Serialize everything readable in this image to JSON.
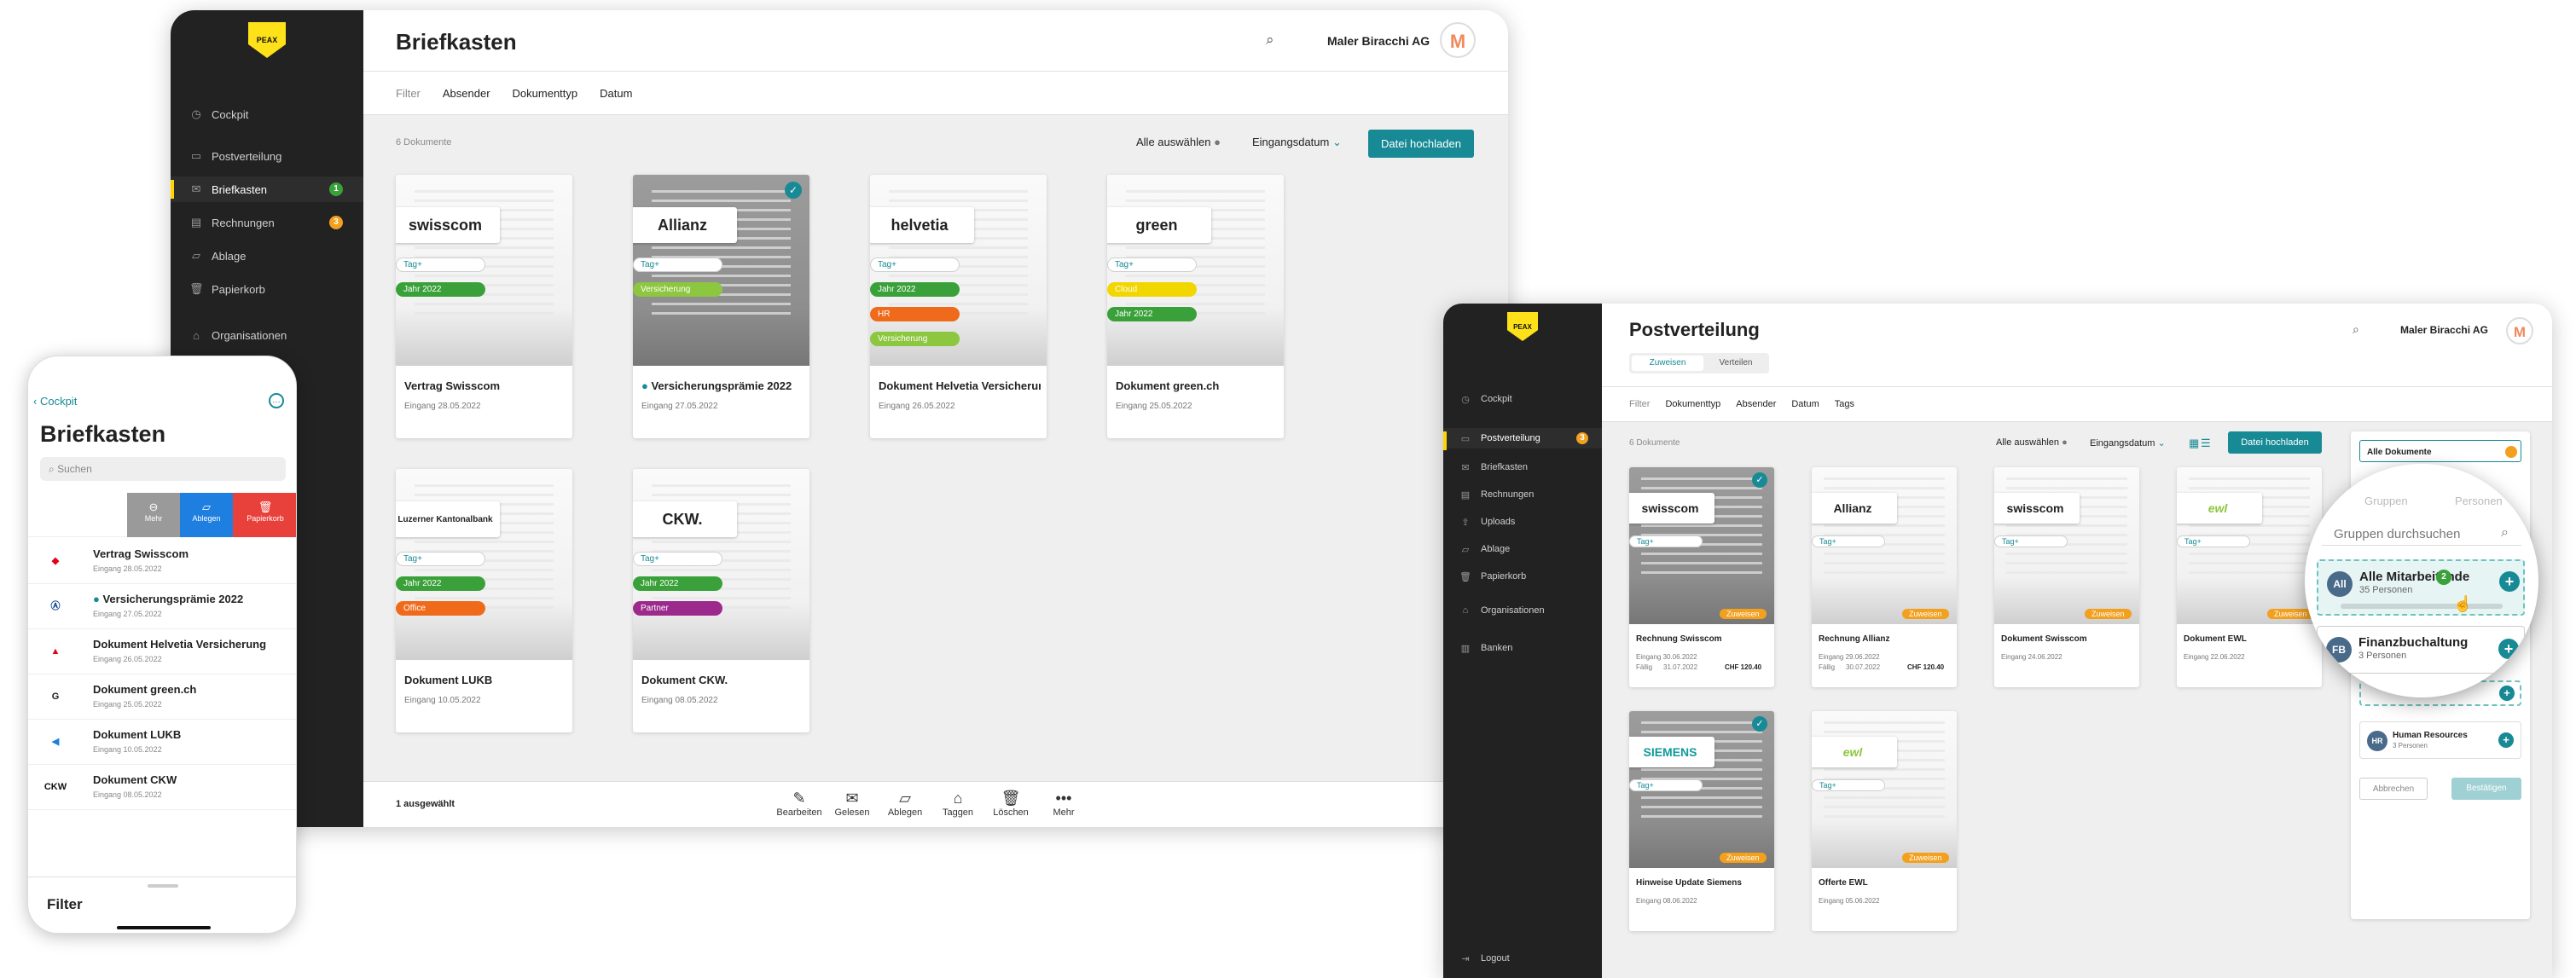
{
  "desktop": {
    "logo": "PEAX",
    "title": "Briefkasten",
    "company": "Maler Biracchi AG",
    "avatar_initial": "M",
    "nav": [
      {
        "label": "Cockpit",
        "icon": "clock"
      },
      {
        "label": "Postverteilung",
        "icon": "inbox"
      },
      {
        "label": "Briefkasten",
        "icon": "mail",
        "badge": "1"
      },
      {
        "label": "Rechnungen",
        "icon": "receipt",
        "badge": "3"
      },
      {
        "label": "Ablage",
        "icon": "folder"
      },
      {
        "label": "Papierkorb",
        "icon": "trash"
      },
      {
        "label": "Organisationen",
        "icon": "org"
      }
    ],
    "filter": {
      "label": "Filter",
      "items": [
        "Absender",
        "Dokumenttyp",
        "Datum"
      ]
    },
    "doc_count": "6 Dokumente",
    "select_all": "Alle auswählen",
    "sort": "Eingangsdatum",
    "upload": "Datei hochladen",
    "cards": [
      {
        "brand": "swisscom",
        "title": "Vertrag Swisscom",
        "date": "Eingang 28.05.2022",
        "tags": [
          {
            "label": "Tag+"
          },
          {
            "label": "Jahr 2022",
            "color": "#3aa13a"
          }
        ]
      },
      {
        "brand": "Allianz",
        "title": "Versicherungsprämie 2022",
        "date": "Eingang 27.05.2022",
        "selected": true,
        "unread": true,
        "tags": [
          {
            "label": "Tag+"
          },
          {
            "label": "Versicherung",
            "color": "#8dc63f"
          }
        ]
      },
      {
        "brand": "helvetia",
        "title": "Dokument Helvetia Versicherung",
        "date": "Eingang 26.05.2022",
        "tags": [
          {
            "label": "Tag+"
          },
          {
            "label": "Jahr 2022",
            "color": "#3aa13a"
          },
          {
            "label": "HR",
            "color": "#ef6a1b"
          },
          {
            "label": "Versicherung",
            "color": "#8dc63f"
          }
        ]
      },
      {
        "brand": "green",
        "title": "Dokument green.ch",
        "date": "Eingang 25.05.2022",
        "tags": [
          {
            "label": "Tag+"
          },
          {
            "label": "Cloud",
            "color": "#f2d600"
          },
          {
            "label": "Jahr 2022",
            "color": "#3aa13a"
          }
        ]
      },
      {
        "brand": "Luzerner Kantonalbank",
        "title": "Dokument LUKB",
        "date": "Eingang 10.05.2022",
        "tags": [
          {
            "label": "Tag+"
          },
          {
            "label": "Jahr 2022",
            "color": "#3aa13a"
          },
          {
            "label": "Office",
            "color": "#ef6a1b"
          }
        ]
      },
      {
        "brand": "CKW.",
        "title": "Dokument CKW.",
        "date": "Eingang 08.05.2022",
        "tags": [
          {
            "label": "Tag+"
          },
          {
            "label": "Jahr 2022",
            "color": "#3aa13a"
          },
          {
            "label": "Partner",
            "color": "#9c2a8d"
          }
        ]
      }
    ],
    "selected_count": "1 ausgewählt",
    "toolbar": [
      {
        "label": "Bearbeiten",
        "icon": "edit"
      },
      {
        "label": "Gelesen",
        "icon": "envelope-open"
      },
      {
        "label": "Ablegen",
        "icon": "folder"
      },
      {
        "label": "Taggen",
        "icon": "tag"
      },
      {
        "label": "Löschen",
        "icon": "trash"
      },
      {
        "label": "Mehr",
        "icon": "more"
      }
    ]
  },
  "phone": {
    "back": "Cockpit",
    "title": "Briefkasten",
    "search_placeholder": "Suchen",
    "swipe_actions": [
      {
        "label": "Mehr",
        "color": "#9a9a9a"
      },
      {
        "label": "Ablegen",
        "color": "#1f7fe0"
      },
      {
        "label": "Papierkorb",
        "color": "#e8403a"
      }
    ],
    "rows": [
      {
        "title": "Vertrag Swisscom",
        "date": "Eingang 28.05.2022",
        "icon": "swisscom"
      },
      {
        "title": "Versicherungsprämie 2022",
        "date": "Eingang 27.05.2022",
        "icon": "allianz",
        "unread": true
      },
      {
        "title": "Dokument Helvetia Versicherung",
        "date": "Eingang 26.05.2022",
        "icon": "helvetia"
      },
      {
        "title": "Dokument green.ch",
        "date": "Eingang 25.05.2022",
        "icon": "green"
      },
      {
        "title": "Dokument LUKB",
        "date": "Eingang 10.05.2022",
        "icon": "lukb"
      },
      {
        "title": "Dokument CKW",
        "date": "Eingang 08.05.2022",
        "icon": "ckw"
      }
    ],
    "footer": "Filter"
  },
  "tablet": {
    "logo": "PEAX",
    "title": "Postverteilung",
    "company": "Maler Biracchi AG",
    "avatar_initial": "M",
    "tabs": [
      "Zuweisen",
      "Verteilen"
    ],
    "nav": [
      {
        "label": "Cockpit"
      },
      {
        "label": "Postverteilung",
        "badge": "3"
      },
      {
        "label": "Briefkasten"
      },
      {
        "label": "Rechnungen"
      },
      {
        "label": "Uploads"
      },
      {
        "label": "Ablage"
      },
      {
        "label": "Papierkorb"
      },
      {
        "label": "Organisationen"
      },
      {
        "label": "Banken"
      }
    ],
    "logout": "Logout",
    "filter": {
      "label": "Filter",
      "items": [
        "Dokumenttyp",
        "Absender",
        "Datum",
        "Tags"
      ]
    },
    "doc_count": "6 Dokumente",
    "select_all": "Alle auswählen",
    "sort": "Eingangsdatum",
    "upload": "Datei hochladen",
    "cards": [
      {
        "brand": "swisscom",
        "title": "Rechnung Swisscom",
        "date": "Eingang 30.06.2022",
        "due": "Fällig",
        "due_date": "31.07.2022",
        "amount": "CHF 120.40",
        "selected": true,
        "status": "Zuweisen"
      },
      {
        "brand": "Allianz",
        "title": "Rechnung Allianz",
        "date": "Eingang 29.06.2022",
        "due": "Fällig",
        "due_date": "30.07.2022",
        "amount": "CHF 120.40",
        "status": "Zuweisen"
      },
      {
        "brand": "swisscom",
        "title": "Dokument Swisscom",
        "date": "Eingang 24.06.2022",
        "status": "Zuweisen"
      },
      {
        "brand": "ewl",
        "title": "Dokument EWL",
        "date": "Eingang 22.06.2022",
        "status": "Zuweisen"
      },
      {
        "brand": "SIEMENS",
        "title": "Hinweise Update Siemens",
        "date": "Eingang 08.06.2022",
        "selected": true,
        "status": "Zuweisen"
      },
      {
        "brand": "ewl",
        "title": "Offerte EWL",
        "date": "Eingang 05.06.2022",
        "status": "Zuweisen"
      }
    ],
    "panel": {
      "all_docs": "Alle Dokumente",
      "tabs": [
        "Gruppen",
        "Personen"
      ],
      "search_placeholder": "Gruppen durchsuchen",
      "groups": [
        {
          "initials": "All",
          "name": "Alle Mitarbeitende",
          "count": "35 Personen",
          "color": "#4a6a8a"
        },
        {
          "initials": "FB",
          "name": "Finanzbuchaltung",
          "count": "3 Personen",
          "color": "#4a6a8a"
        },
        {
          "initials": "HR",
          "name": "Human Resources",
          "count": "3 Personen",
          "color": "#4a6a8a"
        }
      ],
      "cancel": "Abbrechen",
      "confirm": "Bestätigen",
      "drop_badge": "2"
    }
  }
}
